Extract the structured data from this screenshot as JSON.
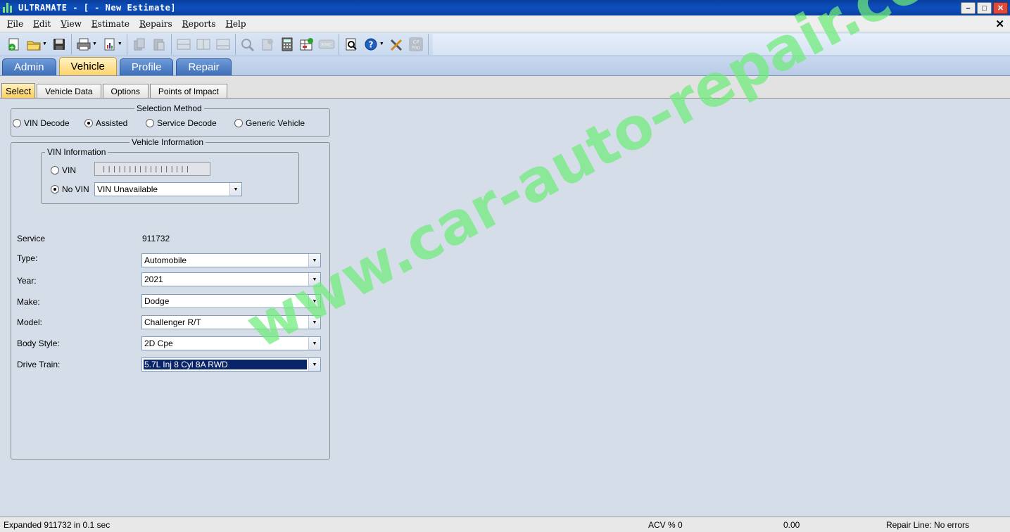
{
  "window": {
    "title": "ULTRAMATE - [ - New Estimate]"
  },
  "menu": [
    "File",
    "Edit",
    "View",
    "Estimate",
    "Repairs",
    "Reports",
    "Help"
  ],
  "main_tabs": [
    {
      "label": "Admin",
      "active": false
    },
    {
      "label": "Vehicle",
      "active": true
    },
    {
      "label": "Profile",
      "active": false
    },
    {
      "label": "Repair",
      "active": false
    }
  ],
  "sub_tabs": [
    {
      "label": "Select",
      "active": true
    },
    {
      "label": "Vehicle Data",
      "active": false
    },
    {
      "label": "Options",
      "active": false
    },
    {
      "label": "Points of Impact",
      "active": false
    }
  ],
  "selection_method": {
    "legend": "Selection Method",
    "options": [
      {
        "label": "VIN Decode",
        "selected": false
      },
      {
        "label": "Assisted",
        "selected": true
      },
      {
        "label": "Service Decode",
        "selected": false
      },
      {
        "label": "Generic Vehicle",
        "selected": false
      }
    ]
  },
  "vehicle_information": {
    "legend": "Vehicle Information",
    "vin_information": {
      "legend": "VIN Information",
      "vin_label": "VIN",
      "vin_mask": "|||||||||||||||||",
      "vin_selected": false,
      "no_vin_label": "No VIN",
      "no_vin_selected": true,
      "no_vin_value": "VIN Unavailable"
    },
    "service": {
      "label": "Service",
      "value": "911732"
    },
    "fields": {
      "type": {
        "label": "Type:",
        "value": "Automobile"
      },
      "year": {
        "label": "Year:",
        "value": "2021"
      },
      "make": {
        "label": "Make:",
        "value": "Dodge"
      },
      "model": {
        "label": "Model:",
        "value": "Challenger R/T"
      },
      "body_style": {
        "label": "Body Style:",
        "value": "2D Cpe"
      },
      "drive_train": {
        "label": "Drive Train:",
        "value": "5.7L Inj 8 Cyl 8A RWD"
      }
    }
  },
  "watermark": "www.car-auto-repair.com",
  "status": {
    "message": "Expanded 911732 in 0.1 sec",
    "acv": "ACV % 0",
    "amount": "0.00",
    "repair_line": "Repair Line: No errors"
  },
  "colors": {
    "accent": "#0a3f9c",
    "active_tab": "#ffd36a",
    "selection": "#0a246a",
    "watermark": "#6eeb78"
  }
}
